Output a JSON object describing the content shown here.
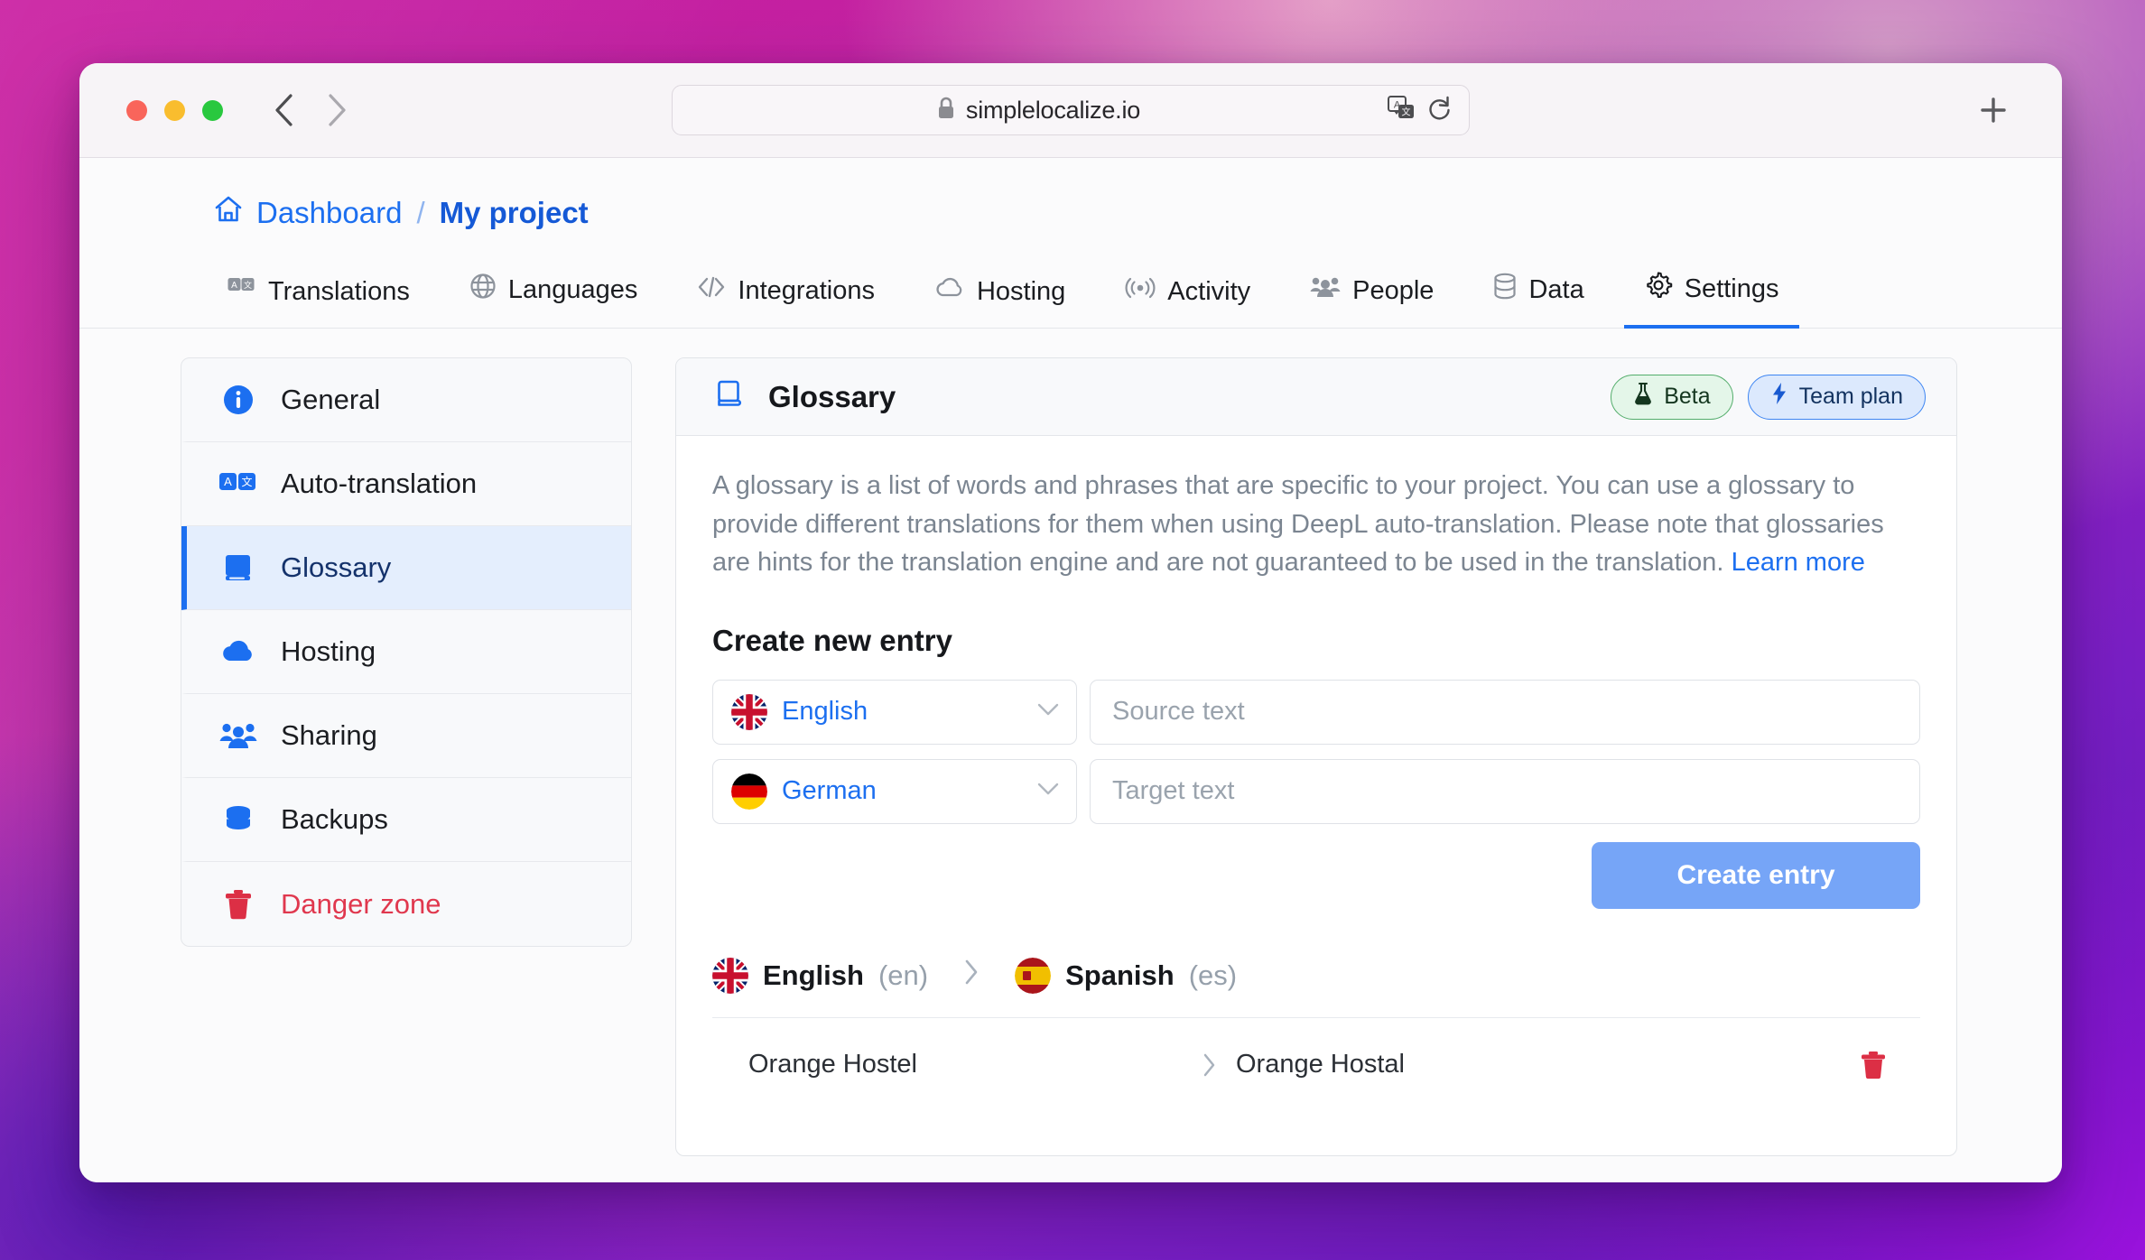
{
  "browser": {
    "url": "simplelocalize.io",
    "lock_icon": "lock-icon",
    "translate_icon": "translate-page-icon",
    "reload_icon": "reload-icon",
    "back_icon": "back-chevron-icon",
    "forward_icon": "forward-chevron-icon",
    "new_tab_icon": "plus-icon"
  },
  "breadcrumb": {
    "home_icon": "home-icon",
    "dashboard": "Dashboard",
    "separator": "/",
    "current": "My project"
  },
  "tabs": [
    {
      "label": "Translations",
      "icon": "translate-box-icon",
      "active": false
    },
    {
      "label": "Languages",
      "icon": "globe-icon",
      "active": false
    },
    {
      "label": "Integrations",
      "icon": "code-brackets-icon",
      "active": false
    },
    {
      "label": "Hosting",
      "icon": "cloud-icon",
      "active": false
    },
    {
      "label": "Activity",
      "icon": "broadcast-icon",
      "active": false
    },
    {
      "label": "People",
      "icon": "people-icon",
      "active": false
    },
    {
      "label": "Data",
      "icon": "database-icon",
      "active": false
    },
    {
      "label": "Settings",
      "icon": "gear-icon",
      "active": true
    }
  ],
  "sidebar": {
    "items": [
      {
        "label": "General",
        "icon": "info-circle-icon",
        "active": false,
        "danger": false
      },
      {
        "label": "Auto-translation",
        "icon": "auto-translate-icon",
        "active": false,
        "danger": false
      },
      {
        "label": "Glossary",
        "icon": "book-icon",
        "active": true,
        "danger": false
      },
      {
        "label": "Hosting",
        "icon": "cloud-icon",
        "active": false,
        "danger": false
      },
      {
        "label": "Sharing",
        "icon": "people-icon",
        "active": false,
        "danger": false
      },
      {
        "label": "Backups",
        "icon": "database-icon",
        "active": false,
        "danger": false
      },
      {
        "label": "Danger zone",
        "icon": "trash-icon",
        "active": false,
        "danger": true
      }
    ]
  },
  "glossary": {
    "title": "Glossary",
    "title_icon": "book-icon",
    "badges": [
      {
        "label": "Beta",
        "icon": "flask-icon",
        "type": "beta"
      },
      {
        "label": "Team plan",
        "icon": "lightning-icon",
        "type": "plan"
      }
    ],
    "description_part1": "A glossary is a list of words and phrases that are specific to your project. You can use a glossary to provide different translations for them when using DeepL auto-translation. Please note that glossaries are hints for the translation engine and are not guaranteed to be used in the translation. ",
    "learn_more": "Learn more",
    "create_title": "Create new entry",
    "source_language": "English",
    "source_flag": "flag-uk",
    "source_placeholder": "Source text",
    "target_language": "German",
    "target_flag": "flag-de",
    "target_placeholder": "Target text",
    "create_button": "Create entry",
    "pair": {
      "source_name": "English",
      "source_code": "(en)",
      "source_flag": "flag-uk",
      "target_name": "Spanish",
      "target_code": "(es)",
      "target_flag": "flag-es",
      "arrow_icon": "chevron-right-icon"
    },
    "entries": [
      {
        "source": "Orange Hostel",
        "target": "Orange Hostal",
        "arrow_icon": "chevron-right-icon",
        "delete_icon": "trash-icon"
      }
    ]
  },
  "colors": {
    "accent_blue": "#1c6ff0",
    "danger_red": "#e0384e",
    "beta_green": "#53ad6b",
    "button_blue": "#76a5f7"
  }
}
